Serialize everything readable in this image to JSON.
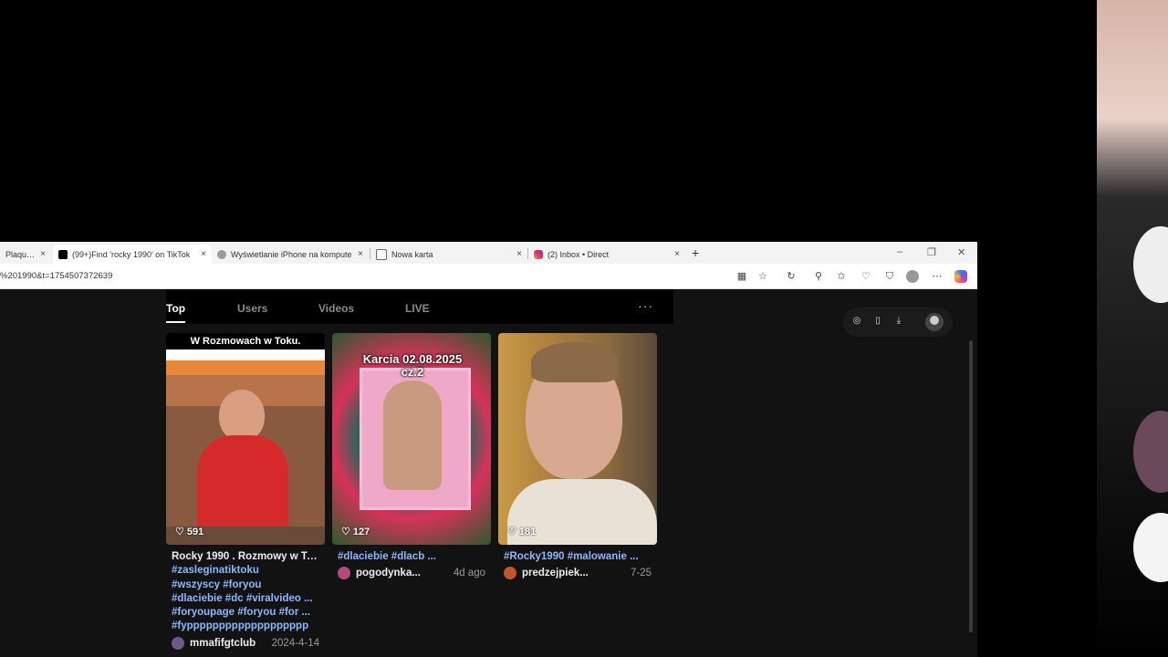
{
  "browser": {
    "tabs": [
      {
        "title": "PlaqueBoy",
        "favicon_color": "#3a3a3a",
        "active": false
      },
      {
        "title": "(99+)Find 'rocky 1990' on TikTok",
        "favicon_color": "#000000",
        "active": true
      },
      {
        "title": "Wyświetlanie iPhone na kompute",
        "favicon_color": "#9a9a9a",
        "active": false
      },
      {
        "title": "Nowa karta",
        "favicon_color": "#5a5a5a",
        "active": false
      },
      {
        "title": "(2) Inbox • Direct",
        "favicon_color": "#e1306c",
        "active": false
      }
    ],
    "close_glyph": "×",
    "new_tab_glyph": "+",
    "url": "%201990&t=1754507372639",
    "window_controls": {
      "minimize": "–",
      "maximize": "❐",
      "close": "✕"
    }
  },
  "tiktok": {
    "tabs": [
      "Top",
      "Users",
      "Videos",
      "LIVE"
    ],
    "more_glyph": "···",
    "videos": [
      {
        "thumb_text": "W Rozmowach w Toku.",
        "likes": "591",
        "desc_plain": "Rocky 1990 . Rozmowy w To...",
        "desc_tags": [
          "#zasleginatiktoku",
          "#wszyscy #foryou",
          "#dlaciebie #dc #viralvideo ...",
          "#foryoupage #foryou #for ...",
          "#fyppppppppppppppppppp"
        ],
        "user": "mmafifgtclub",
        "date": "2024-4-14",
        "avatar_color": "#6c5a8a"
      },
      {
        "thumb_text": "Karcia 02.08.2025 cz.2",
        "likes": "127",
        "desc_plain": "",
        "desc_tags": [
          "#dlaciebie #dlacb ..."
        ],
        "user": "pogodynka...",
        "date": "4d ago",
        "avatar_color": "#b04a7a"
      },
      {
        "thumb_text": "",
        "likes": "181",
        "desc_plain": "",
        "desc_tags": [
          "#Rocky1990 #malowanie ..."
        ],
        "user": "predzejpiek...",
        "date": "7-25",
        "avatar_color": "#c0562a"
      }
    ]
  }
}
